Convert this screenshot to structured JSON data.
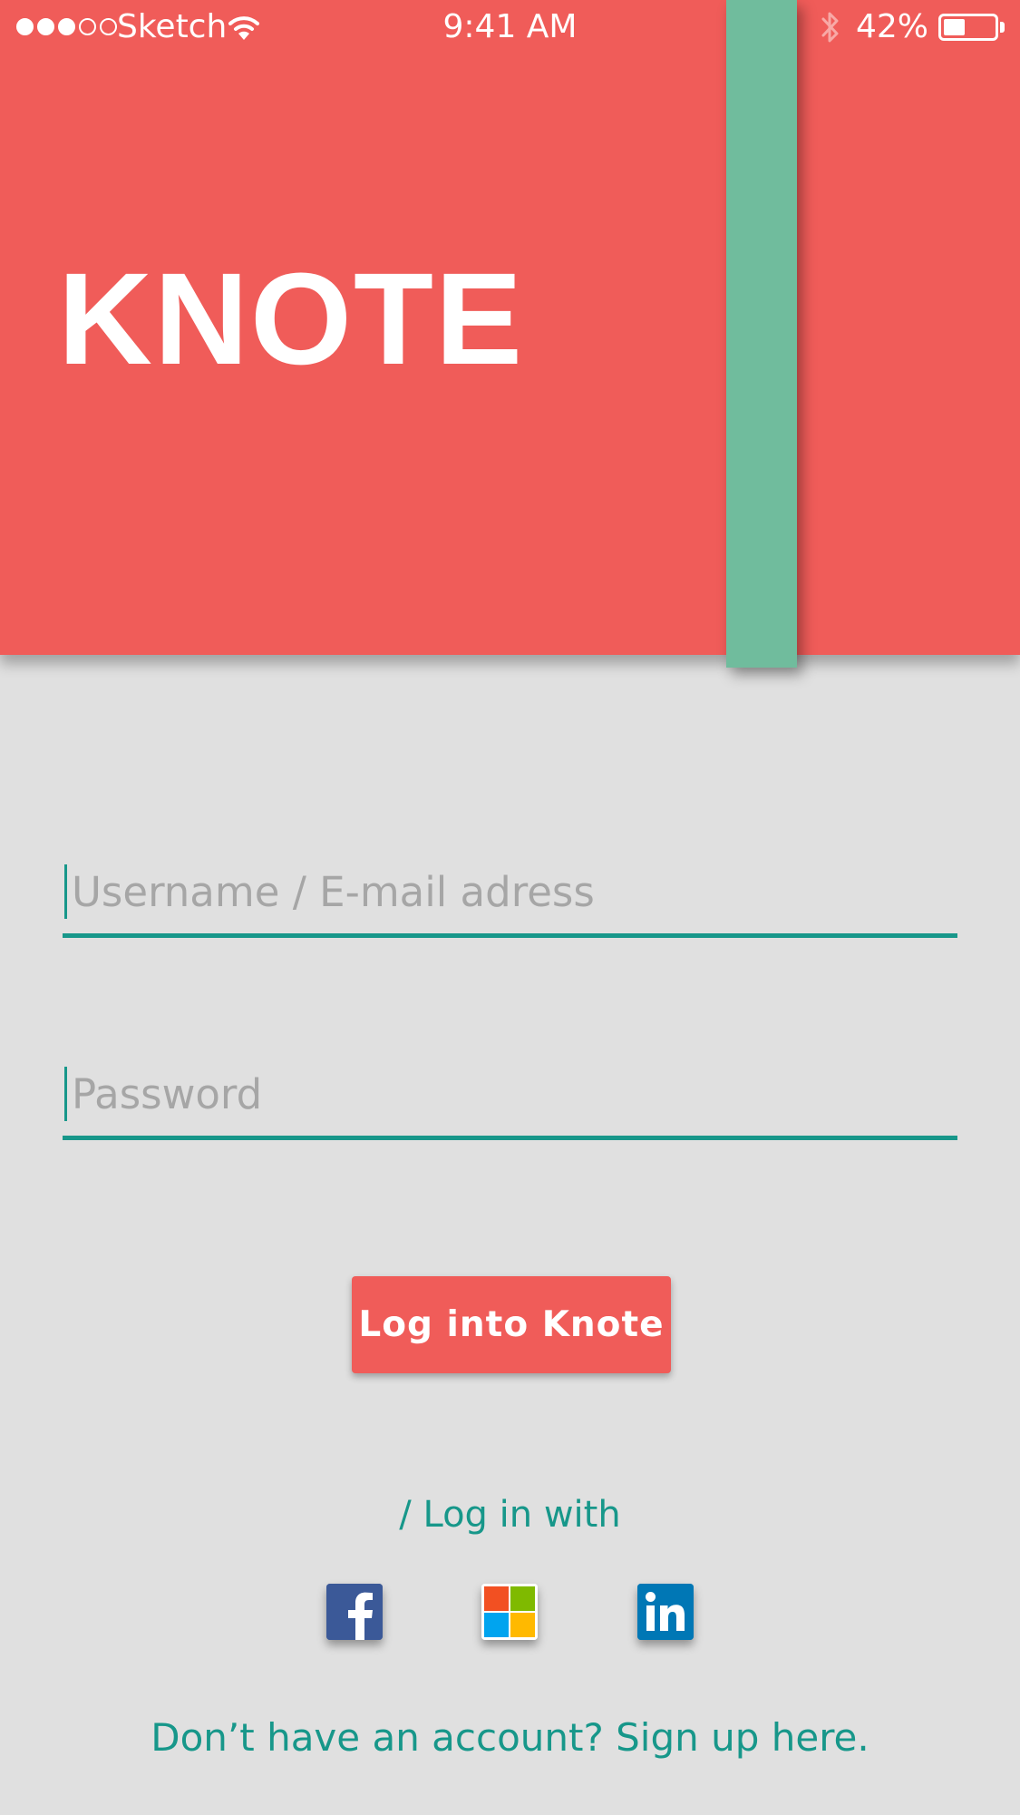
{
  "status_bar": {
    "carrier": "Sketch",
    "time": "9:41 AM",
    "battery_percent": "42%",
    "battery_level": 0.42,
    "signal_bars_filled": 3,
    "signal_bars_total": 5,
    "icons": [
      "signal-dots-icon",
      "wifi-icon",
      "bluetooth-icon",
      "battery-icon"
    ]
  },
  "header": {
    "title": "KNOTE",
    "background_color": "#f05c59",
    "bookmark_color": "#70bc9d"
  },
  "form": {
    "username": {
      "placeholder": "Username / E-mail adress",
      "value": ""
    },
    "password": {
      "placeholder": "Password",
      "value": ""
    },
    "accent_color": "#17978a"
  },
  "login_button": {
    "label": "Log into Knote"
  },
  "social_login": {
    "label": "/ Log in with",
    "providers": [
      {
        "name": "facebook",
        "icon": "facebook-icon",
        "color": "#3b5998"
      },
      {
        "name": "microsoft",
        "icon": "microsoft-icon",
        "color": "#ffffff"
      },
      {
        "name": "linkedin",
        "icon": "linkedin-icon",
        "color": "#0077b5"
      }
    ]
  },
  "signup": {
    "text": "Don’t have an account? Sign up here."
  }
}
